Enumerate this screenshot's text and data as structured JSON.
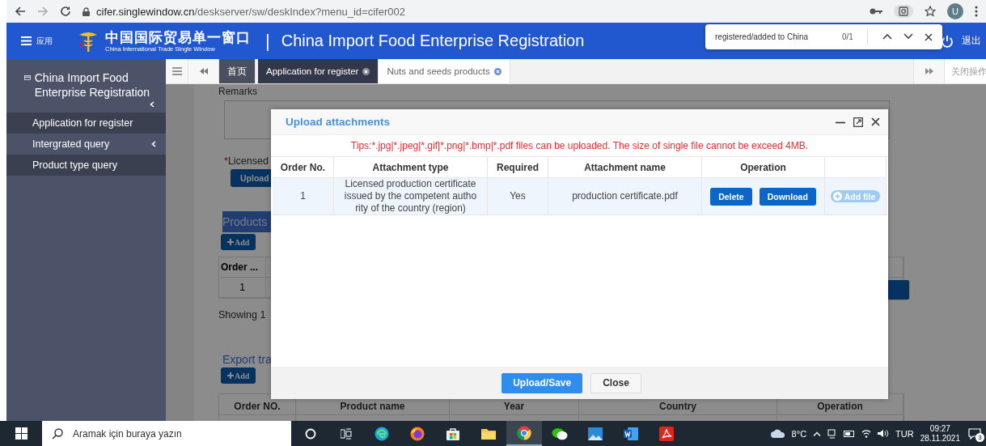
{
  "browser": {
    "url_host": "cifer.singlewindow.cn",
    "url_path": "/deskserver/sw/deskIndex?menu_id=cifer002",
    "profile_initial": "U"
  },
  "find_bar": {
    "query": "registered/added to China",
    "count": "0/1"
  },
  "header": {
    "menu_label": "应用",
    "logo_title": "中国国际贸易单一窗口",
    "logo_subtitle": "China International Trade Single Window",
    "separator": "|",
    "app_title": "China Import Food Enterprise Registration",
    "logout_label": "退出"
  },
  "sidebar": {
    "title": "China Import Food Enterprise Registration",
    "items": [
      {
        "label": "Application for register",
        "highlighted": true,
        "has_submenu": false
      },
      {
        "label": "Intergrated query",
        "highlighted": false,
        "has_submenu": true
      },
      {
        "label": "Product type query",
        "highlighted": true,
        "has_submenu": false
      }
    ]
  },
  "tabs": [
    {
      "label": "首页",
      "kind": "home",
      "selected": false,
      "closable": false
    },
    {
      "label": "Application for register",
      "kind": "page",
      "selected": true,
      "closable": true
    },
    {
      "label": "Nuts and seeds products",
      "kind": "page",
      "selected": false,
      "closable": true
    }
  ],
  "close_menu_label": "关闭操作",
  "form": {
    "remarks_label": "Remarks",
    "licensed_marker": "*",
    "licensed_label": "Licensed",
    "upload_button": "Upload",
    "products_heading": "Products",
    "products_add": "Add",
    "products_table": {
      "column_1": "Order ...",
      "rows": [
        [
          "1"
        ]
      ]
    },
    "showing": "Showing 1",
    "export_heading": "Export tra",
    "export_add": "Add",
    "export_columns": [
      "Order NO.",
      "Product name",
      "Year",
      "Country",
      "Operation"
    ]
  },
  "modal": {
    "title": "Upload attachments",
    "tips": "Tips:*.jpg|*.jpeg|*.gif|*.png|*.bmp|*.pdf files can be uploaded. The size of single file cannot be exceed 4MB.",
    "columns": [
      "Order No.",
      "Attachment type",
      "Required",
      "Attachment name",
      "Operation"
    ],
    "rows": [
      {
        "order": "1",
        "type": "Licensed production certificate issued by the competent authority of the country (region)",
        "required": "Yes",
        "name": "production certificate.pdf",
        "actions": [
          "Delete",
          "Download"
        ],
        "add_label": "Add file"
      }
    ],
    "buttons": [
      {
        "label": "Upload/Save",
        "kind": "primary"
      },
      {
        "label": "Close",
        "kind": "default"
      }
    ]
  },
  "taskbar": {
    "search_placeholder": "Aramak için buraya yazın",
    "apps": [
      {
        "kind": "cortana",
        "active": false
      },
      {
        "kind": "taskview",
        "active": false
      },
      {
        "kind": "edge",
        "active": false
      },
      {
        "kind": "firefox",
        "active": false
      },
      {
        "kind": "store",
        "active": false
      },
      {
        "kind": "explorer",
        "active": false
      },
      {
        "kind": "chrome",
        "active": true
      },
      {
        "kind": "wechat",
        "active": false
      },
      {
        "kind": "photos",
        "active": false
      },
      {
        "kind": "word",
        "active": false
      },
      {
        "kind": "acrobat",
        "active": false
      }
    ],
    "weather": "8°C",
    "language": "TUR",
    "time": "09:27",
    "date": "28.11.2021",
    "notifications": "3"
  }
}
